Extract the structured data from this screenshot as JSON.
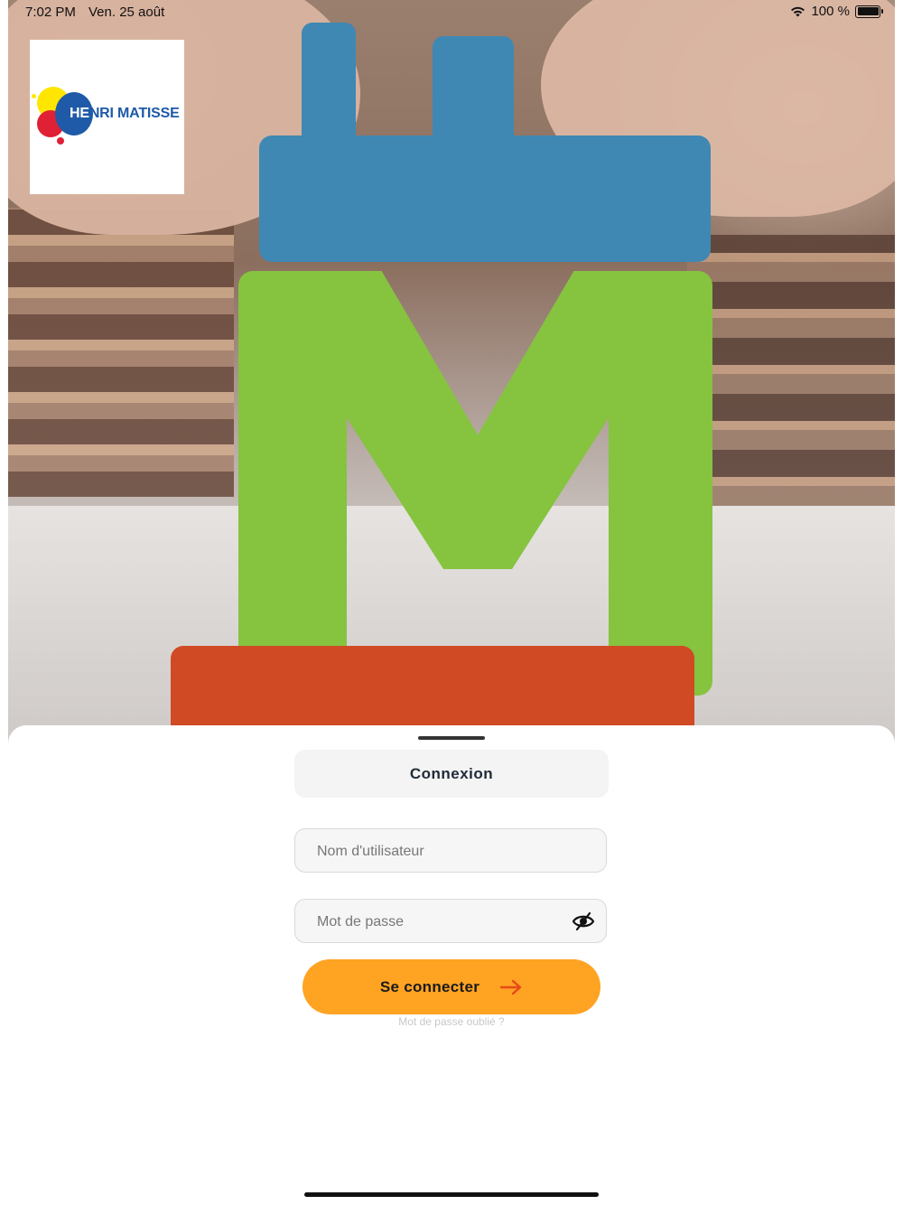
{
  "status_bar": {
    "time": "7:02 PM",
    "date": "Ven. 25 août",
    "battery_text": "100 %",
    "icons": [
      "wifi-icon",
      "battery-icon"
    ]
  },
  "logo": {
    "text_part_white": "HE",
    "text_part_blue": "NRI MATISSE",
    "colors": {
      "yellow": "#ffe600",
      "blue": "#1e5aa8",
      "red": "#e02035"
    }
  },
  "login": {
    "tab_label": "Connexion",
    "username_placeholder": "Nom d'utilisateur",
    "username_value": "",
    "password_placeholder": "Mot de passe",
    "password_value": "",
    "password_toggle_icon": "eye-slash-icon",
    "submit_label": "Se connecter",
    "submit_icon": "arrow-right-icon",
    "forgot_label": "Mot de passe oublié ?"
  },
  "colors": {
    "accent": "#ffa323",
    "arrow": "#e84a1a",
    "tab_bg": "#f4f4f4",
    "text_dark": "#1f2a37"
  }
}
